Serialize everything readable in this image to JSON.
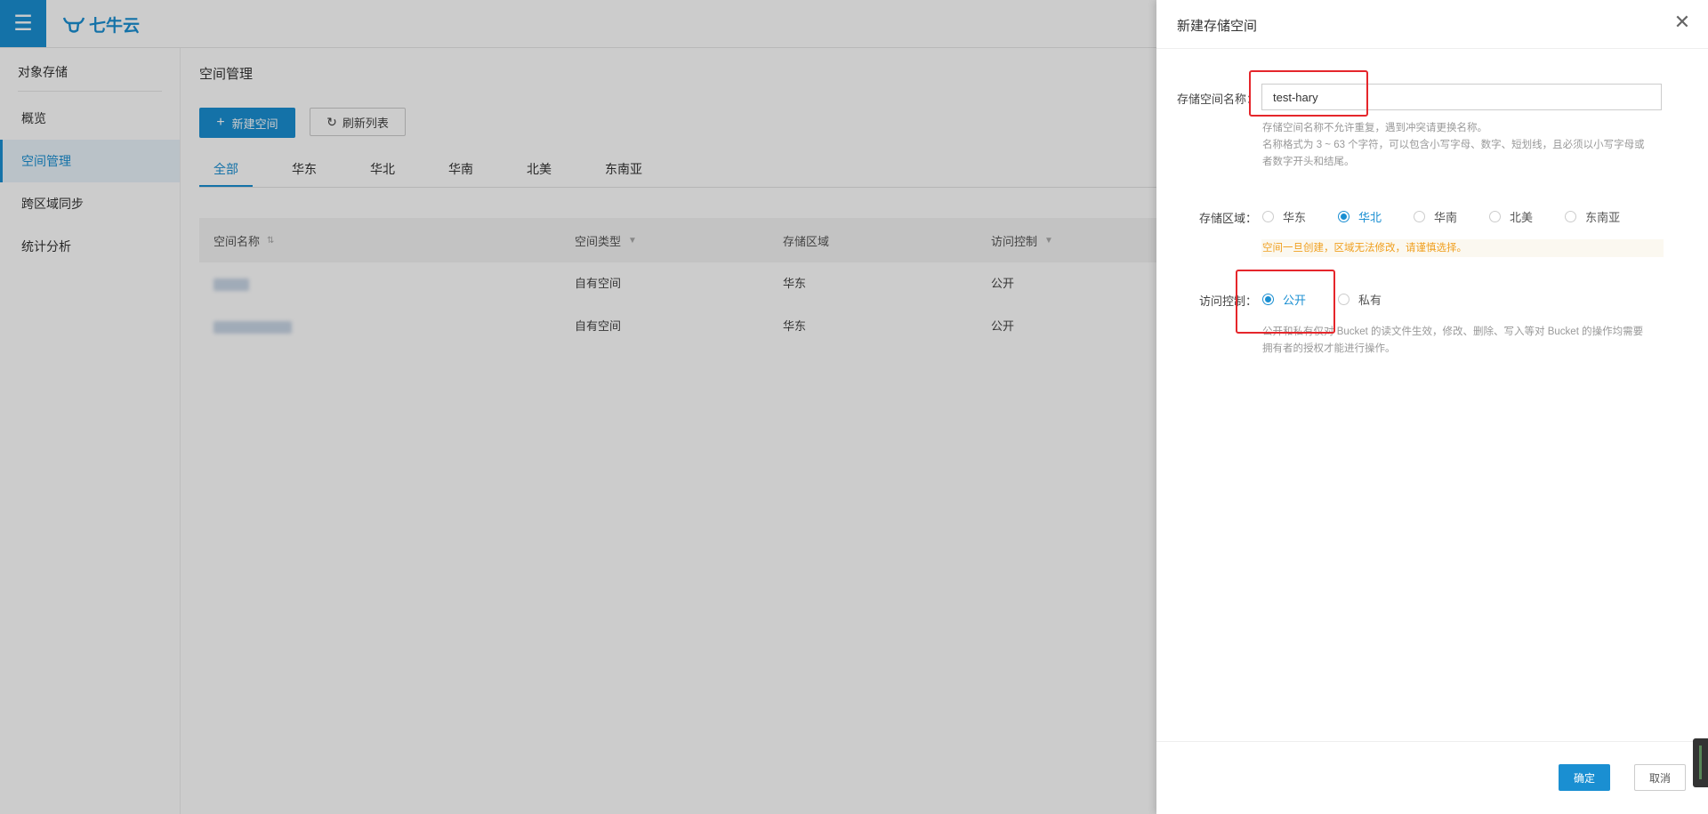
{
  "topbar": {
    "logo_text": "七牛云"
  },
  "sidebar": {
    "title": "对象存储",
    "items": [
      {
        "label": "概览"
      },
      {
        "label": "空间管理"
      },
      {
        "label": "跨区域同步"
      },
      {
        "label": "统计分析"
      }
    ]
  },
  "main": {
    "title": "空间管理",
    "new_button": "新建空间",
    "refresh_button": "刷新列表",
    "tabs": [
      {
        "label": "全部"
      },
      {
        "label": "华东"
      },
      {
        "label": "华北"
      },
      {
        "label": "华南"
      },
      {
        "label": "北美"
      },
      {
        "label": "东南亚"
      }
    ],
    "table": {
      "columns": [
        "空间名称",
        "空间类型",
        "存储区域",
        "访问控制"
      ],
      "rows": [
        {
          "type": "自有空间",
          "region": "华东",
          "access": "公开"
        },
        {
          "type": "自有空间",
          "region": "华东",
          "access": "公开"
        }
      ]
    }
  },
  "drawer": {
    "title": "新建存储空间",
    "name_label": "存储空间名称：",
    "name_value": "test-hary",
    "name_hint_1": "存储空间名称不允许重复，遇到冲突请更换名称。",
    "name_hint_2": "名称格式为 3 ~ 63 个字符，可以包含小写字母、数字、短划线，且必须以小写字母或",
    "name_hint_3": "者数字开头和结尾。",
    "region_label": "存储区域：",
    "regions": [
      {
        "label": "华东",
        "checked": false
      },
      {
        "label": "华北",
        "checked": true
      },
      {
        "label": "华南",
        "checked": false
      },
      {
        "label": "北美",
        "checked": false
      },
      {
        "label": "东南亚",
        "checked": false
      }
    ],
    "region_warning": "空间一旦创建，区域无法修改，请谨慎选择。",
    "access_label": "访问控制：",
    "access_options": [
      {
        "label": "公开",
        "checked": true
      },
      {
        "label": "私有",
        "checked": false
      }
    ],
    "access_hint_1": "公开和私有仅对 Bucket 的读文件生效，修改、删除、写入等对 Bucket 的操作均需要",
    "access_hint_2": "拥有者的授权才能进行操作。",
    "ok_button": "确定",
    "cancel_button": "取消"
  },
  "colors": {
    "accent": "#1a8fd2",
    "warning": "#f0a020",
    "highlight": "#e5262b"
  }
}
